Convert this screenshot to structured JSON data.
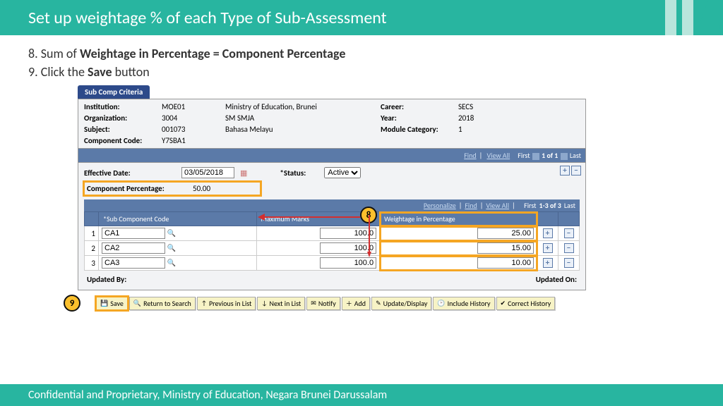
{
  "slide": {
    "title": "Set up weightage % of each Type of Sub-Assessment",
    "step8_prefix": "8. Sum of ",
    "step8_bold": "Weightage in Percentage = Component Percentage",
    "step9_prefix": "9. Click the ",
    "step9_bold": "Save",
    "step9_suffix": " button",
    "footer": "Confidential and Proprietary, Ministry of Education, Negara Brunei Darussalam",
    "callout8": "8",
    "callout9": "9"
  },
  "app": {
    "tab": "Sub Comp Criteria",
    "info": {
      "institution_lbl": "Institution:",
      "institution_code": "MOE01",
      "institution_name": "Ministry of Education, Brunei",
      "career_lbl": "Career:",
      "career_val": "SECS",
      "org_lbl": "Organization:",
      "org_code": "3004",
      "org_name": "SM SMJA",
      "year_lbl": "Year:",
      "year_val": "2018",
      "subject_lbl": "Subject:",
      "subject_code": "001073",
      "subject_name": "Bahasa Melayu",
      "modcat_lbl": "Module Category:",
      "modcat_val": "1",
      "compcode_lbl": "Component Code:",
      "compcode_val": "Y7SBA1"
    },
    "nav1": {
      "find": "Find",
      "viewall": "View All",
      "first": "First",
      "pos": "1 of 1",
      "last": "Last"
    },
    "form": {
      "effdate_lbl": "Effective Date:",
      "effdate_val": "03/05/2018",
      "status_lbl": "*Status:",
      "status_val": "Active",
      "comppct_lbl": "Component Percentage:",
      "comppct_val": "50.00",
      "updby_lbl": "Updated By:",
      "updon_lbl": "Updated On:"
    },
    "nav2": {
      "personalize": "Personalize",
      "find": "Find",
      "viewall": "View All",
      "first": "First",
      "pos": "1-3 of 3",
      "last": "Last"
    },
    "grid": {
      "h_sub": "*Sub Component Code",
      "h_max": "Maximum Marks",
      "h_wgt": "Weightage in Percentage",
      "rows": [
        {
          "n": "1",
          "code": "CA1",
          "max": "100.0",
          "wgt": "25.00"
        },
        {
          "n": "2",
          "code": "CA2",
          "max": "100.0",
          "wgt": "15.00"
        },
        {
          "n": "3",
          "code": "CA3",
          "max": "100.0",
          "wgt": "10.00"
        }
      ]
    },
    "buttons": {
      "save": "Save",
      "return": "Return to Search",
      "prev": "Previous in List",
      "next": "Next in List",
      "notify": "Notify",
      "add": "Add",
      "update": "Update/Display",
      "inchist": "Include History",
      "corrhist": "Correct History"
    }
  }
}
